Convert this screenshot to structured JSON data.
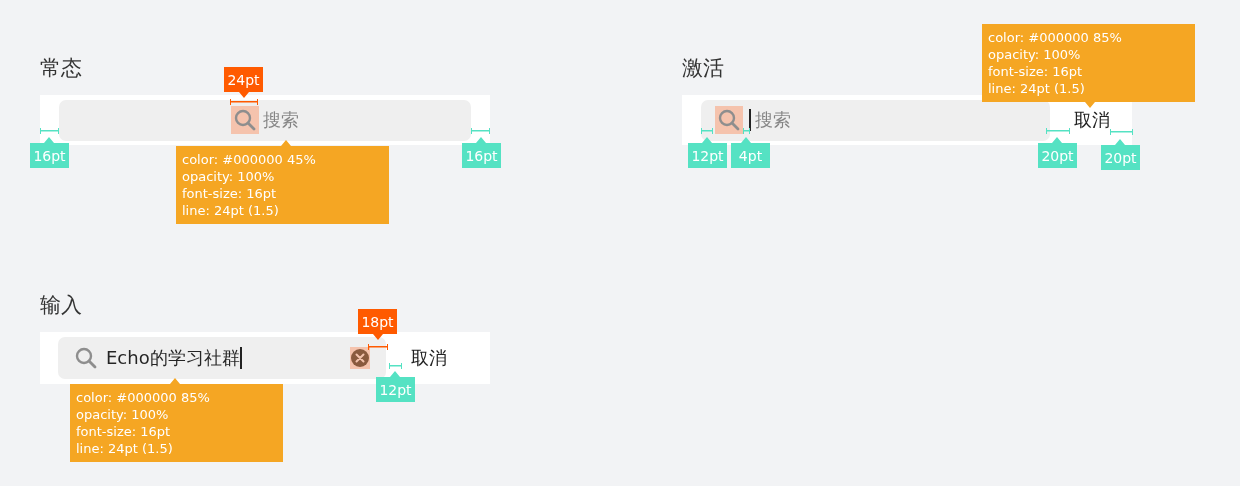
{
  "sections": [
    {
      "kind": "normal",
      "title": "常态",
      "placeholder": "搜索",
      "search_icon_highlighted": true,
      "annotations": [
        {
          "kind": "size",
          "text": "24pt"
        },
        {
          "kind": "spacing",
          "text": "16pt"
        },
        {
          "kind": "spec",
          "lines": [
            "color: #000000 45%",
            "opacity: 100%",
            "font-size: 16pt",
            "line: 24pt (1.5)"
          ]
        },
        {
          "kind": "spacing",
          "text": "16pt"
        }
      ]
    },
    {
      "kind": "active",
      "title": "激活",
      "placeholder": "搜索",
      "search_icon_highlighted": true,
      "cursor": true,
      "cancel": "取消",
      "annotations": [
        {
          "kind": "spec",
          "lines": [
            "color: #000000 85%",
            "opacity: 100%",
            "font-size: 16pt",
            "line: 24pt (1.5)"
          ]
        },
        {
          "kind": "spacing",
          "text": "12pt"
        },
        {
          "kind": "spacing",
          "text": "4pt"
        },
        {
          "kind": "spacing",
          "text": "20pt"
        },
        {
          "kind": "spacing",
          "text": "20pt"
        }
      ]
    },
    {
      "kind": "input",
      "title": "输入",
      "value": "Echo的学习社群",
      "search_icon_highlighted": false,
      "cursor": true,
      "clear_highlighted": true,
      "cancel": "取消",
      "annotations": [
        {
          "kind": "size",
          "text": "18pt"
        },
        {
          "kind": "spacing",
          "text": "12pt"
        },
        {
          "kind": "spec",
          "lines": [
            "color: #000000 85%",
            "opacity: 100%",
            "font-size: 16pt",
            "line: 24pt (1.5)"
          ]
        }
      ]
    }
  ]
}
